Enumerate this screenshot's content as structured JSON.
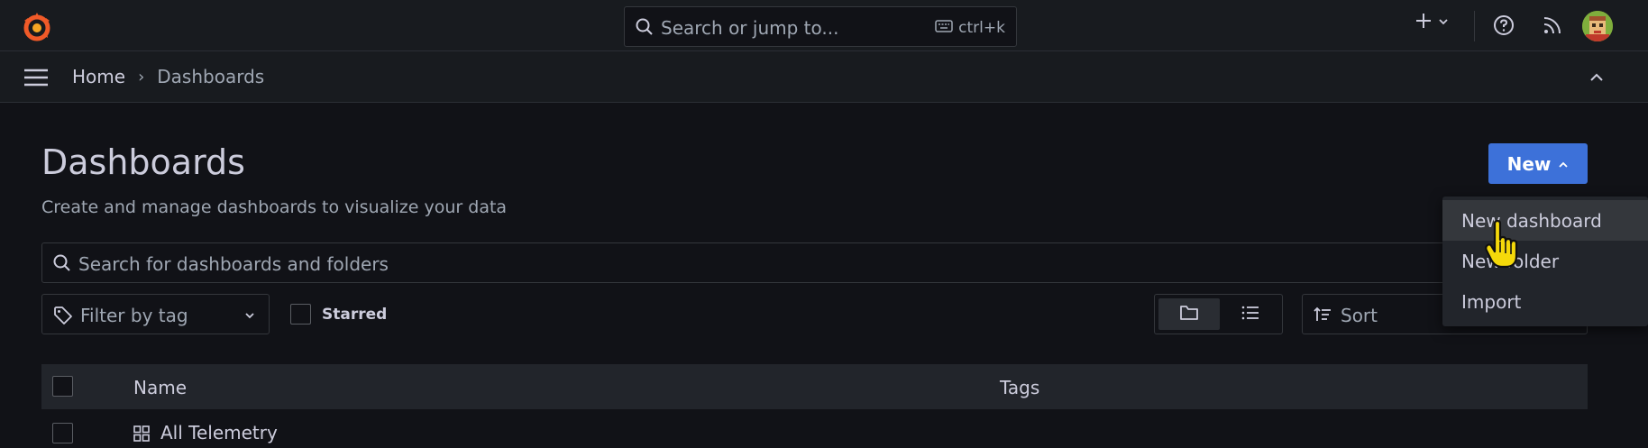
{
  "topbar": {
    "search_placeholder": "Search or jump to...",
    "search_shortcut": "ctrl+k",
    "icons": [
      "grafana-logo-icon",
      "search-icon",
      "keyboard-icon",
      "plus-icon",
      "chevron-down-icon",
      "help-icon",
      "rss-icon",
      "user-avatar"
    ]
  },
  "breadcrumb": {
    "home": "Home",
    "separator": "›",
    "current": "Dashboards"
  },
  "page": {
    "title": "Dashboards",
    "subtitle": "Create and manage dashboards to visualize your data",
    "new_button": "New"
  },
  "filters": {
    "search_placeholder": "Search for dashboards and folders",
    "tag_placeholder": "Filter by tag",
    "starred_label": "Starred",
    "sort_placeholder": "Sort"
  },
  "table": {
    "columns": [
      "Name",
      "Tags"
    ],
    "rows": [
      {
        "name": "All Telemetry"
      }
    ]
  },
  "new_menu": {
    "items": [
      "New dashboard",
      "New folder",
      "Import"
    ]
  },
  "colors": {
    "background": "#111217",
    "panel": "#181b1f",
    "primary": "#3d71d9",
    "text": "#ccccdc",
    "muted": "#9fa7b3",
    "logo_orange": "#f05a28"
  }
}
